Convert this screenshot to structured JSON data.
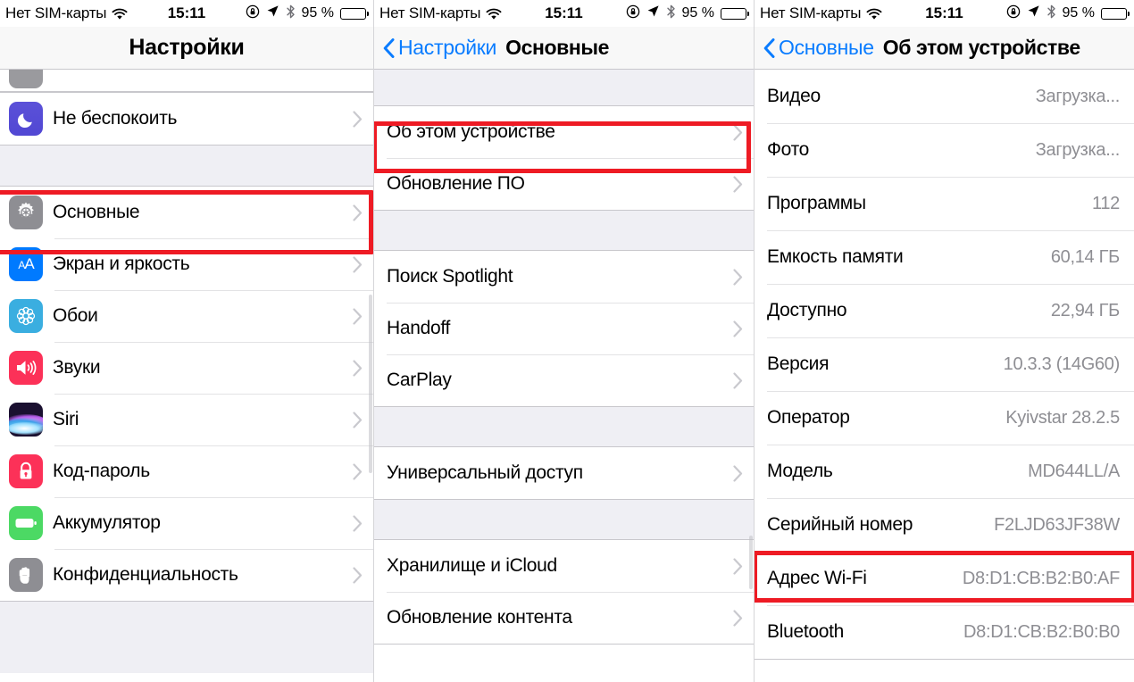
{
  "status_bar": {
    "carrier": "Нет SIM-карты",
    "wifi_icon": "wifi-icon",
    "time": "15:11",
    "rotation_lock_icon": "rotation-lock-icon",
    "location_icon": "location-arrow-icon",
    "bluetooth_icon": "bluetooth-icon",
    "battery_percent": "95 %",
    "battery_icon": "battery-icon",
    "battery_level": 95
  },
  "colors": {
    "accent_blue": "#0a7cff",
    "highlight_red": "#ee1b24",
    "value_gray": "#8e8e93",
    "group_bg": "#efeff4"
  },
  "panel1": {
    "nav": {
      "title": "Настройки"
    },
    "partial_top_row": {
      "label": "",
      "icon": "cut-off-icon"
    },
    "groups": [
      {
        "rows": [
          {
            "label": "Не беспокоить",
            "icon": "moon-icon",
            "icon_class": "ic-moon",
            "chevron": true
          }
        ]
      },
      {
        "rows": [
          {
            "label": "Основные",
            "icon": "gear-icon",
            "icon_class": "ic-gear",
            "chevron": true,
            "highlighted": true
          },
          {
            "label": "Экран и яркость",
            "icon": "text-size-icon",
            "icon_class": "ic-aa",
            "chevron": true
          },
          {
            "label": "Обои",
            "icon": "wallpaper-icon",
            "icon_class": "ic-wall",
            "chevron": true
          },
          {
            "label": "Звуки",
            "icon": "speaker-icon",
            "icon_class": "ic-snd",
            "chevron": true
          },
          {
            "label": "Siri",
            "icon": "siri-icon",
            "icon_class": "ic-siri",
            "chevron": true
          },
          {
            "label": "Код-пароль",
            "icon": "lock-icon",
            "icon_class": "ic-lock",
            "chevron": true
          },
          {
            "label": "Аккумулятор",
            "icon": "battery-icon",
            "icon_class": "ic-batt",
            "chevron": true
          },
          {
            "label": "Конфиденциальность",
            "icon": "hand-icon",
            "icon_class": "ic-hand",
            "chevron": true
          }
        ]
      }
    ]
  },
  "panel2": {
    "nav": {
      "back_label": "Настройки",
      "title": "Основные"
    },
    "groups": [
      {
        "rows": [
          {
            "label": "Об этом устройстве",
            "chevron": true,
            "highlighted": true
          },
          {
            "label": "Обновление ПО",
            "chevron": true
          }
        ]
      },
      {
        "rows": [
          {
            "label": "Поиск Spotlight",
            "chevron": true
          },
          {
            "label": "Handoff",
            "chevron": true
          },
          {
            "label": "CarPlay",
            "chevron": true
          }
        ]
      },
      {
        "rows": [
          {
            "label": "Универсальный доступ",
            "chevron": true
          }
        ]
      },
      {
        "rows": [
          {
            "label": "Хранилище и iCloud",
            "chevron": true
          },
          {
            "label": "Обновление контента",
            "chevron": true
          }
        ]
      }
    ]
  },
  "panel3": {
    "nav": {
      "back_label": "Основные",
      "title": "Об этом устройстве"
    },
    "rows": [
      {
        "label": "Видео",
        "value": "Загрузка..."
      },
      {
        "label": "Фото",
        "value": "Загрузка..."
      },
      {
        "label": "Программы",
        "value": "112"
      },
      {
        "label": "Емкость памяти",
        "value": "60,14 ГБ"
      },
      {
        "label": "Доступно",
        "value": "22,94 ГБ"
      },
      {
        "label": "Версия",
        "value": "10.3.3 (14G60)"
      },
      {
        "label": "Оператор",
        "value": "Kyivstar 28.2.5"
      },
      {
        "label": "Модель",
        "value": "MD644LL/A"
      },
      {
        "label": "Серийный номер",
        "value": "F2LJD63JF38W"
      },
      {
        "label": "Адрес Wi-Fi",
        "value": "D8:D1:CB:B2:B0:AF",
        "highlighted": true
      },
      {
        "label": "Bluetooth",
        "value": "D8:D1:CB:B2:B0:B0"
      }
    ]
  }
}
